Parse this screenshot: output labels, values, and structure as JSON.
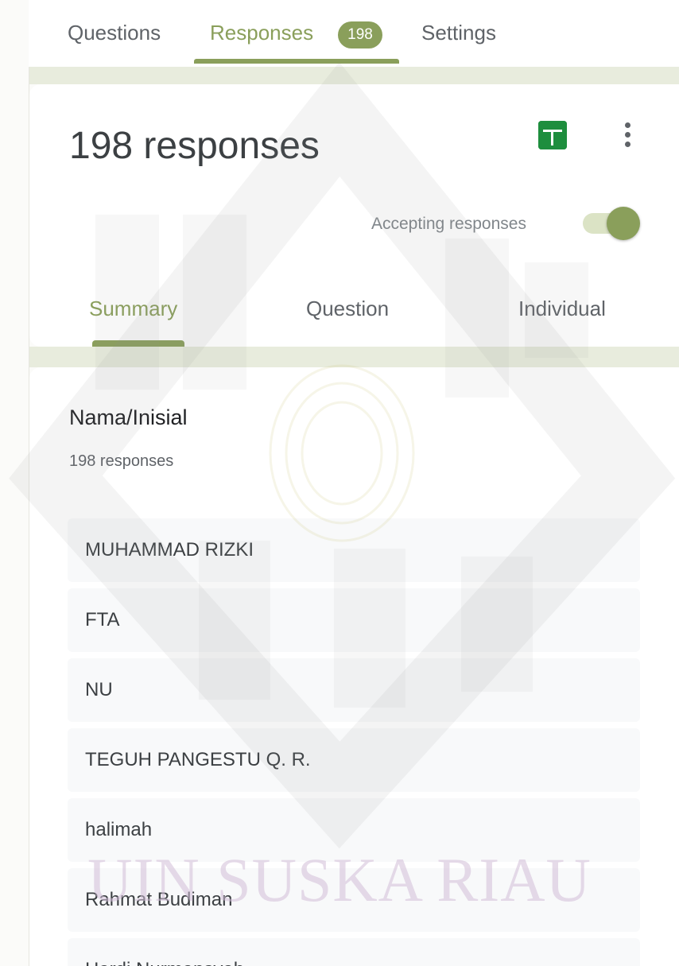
{
  "top_tabs": {
    "questions": "Questions",
    "responses": "Responses",
    "responses_count": "198",
    "settings": "Settings"
  },
  "header": {
    "title": "198 responses",
    "sheets_icon": "google-sheets-icon",
    "more_icon": "more-vert-icon",
    "accepting_label": "Accepting responses",
    "accepting_on": true
  },
  "sub_tabs": {
    "summary": "Summary",
    "question": "Question",
    "individual": "Individual"
  },
  "question": {
    "title": "Nama/Inisial",
    "count_label": "198 responses",
    "answers": [
      "MUHAMMAD RIZKI",
      "FTA",
      "NU",
      "TEGUH PANGESTU Q. R.",
      "halimah",
      "Rahmat Budiman",
      "Hardi Nurmansyah"
    ]
  },
  "watermark": {
    "text": "UIN SUSKA RIAU"
  },
  "colors": {
    "accent": "#8a9f5b",
    "sheets_green": "#1e8e3e",
    "band": "#e8ecdd",
    "watermark": "#c8a2c8"
  }
}
